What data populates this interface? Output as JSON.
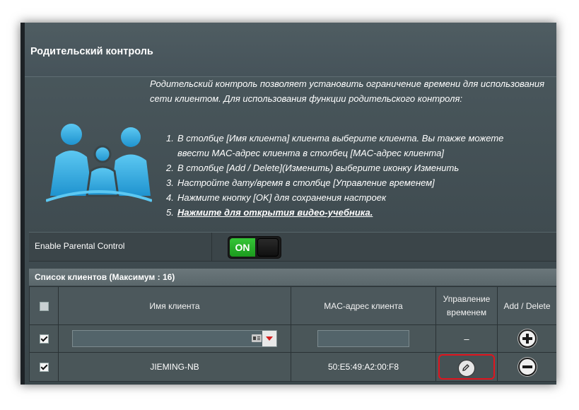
{
  "page": {
    "title": "Родительский контроль",
    "intro": "Родительский контроль позволяет установить ограничение времени для использования сети клиентом. Для использования функции родительского контроля:",
    "steps": [
      {
        "num": "1.",
        "text": "В столбце [Имя клиента] клиента выберите клиента. Вы также можете"
      },
      {
        "num": "",
        "text": "ввести MAC-адрес клиента в столбец [MAC-адрес клиента]"
      },
      {
        "num": "2.",
        "text": "В столбце [Add / Delete](Изменить) выберите иконку Изменить"
      },
      {
        "num": "3.",
        "text": "Настройте дату/время в столбце [Управление временем]"
      },
      {
        "num": "4.",
        "text": "Нажмите кнопку [OK] для сохранения настроек"
      },
      {
        "num": "5.",
        "text": "Нажмите для открытия видео-учебника."
      }
    ]
  },
  "enable": {
    "label": "Enable Parental Control",
    "toggle_on_label": "ON"
  },
  "client_list": {
    "title": "Список клиентов (Максимум : 16)",
    "columns": {
      "name": "Имя клиента",
      "mac": "MAC-адрес клиента",
      "time": "Управление временем",
      "add_delete": "Add / Delete"
    },
    "input_row": {
      "name_value": "",
      "mac_value": "",
      "time_placeholder": "–"
    },
    "rows": [
      {
        "name": "JIEMING-NB",
        "mac": "50:E5:49:A2:00:F8"
      }
    ]
  },
  "colors": {
    "accent_blue": "#3ab3e6",
    "toggle_green": "#2bb52d",
    "highlight_red": "#e0141e"
  }
}
